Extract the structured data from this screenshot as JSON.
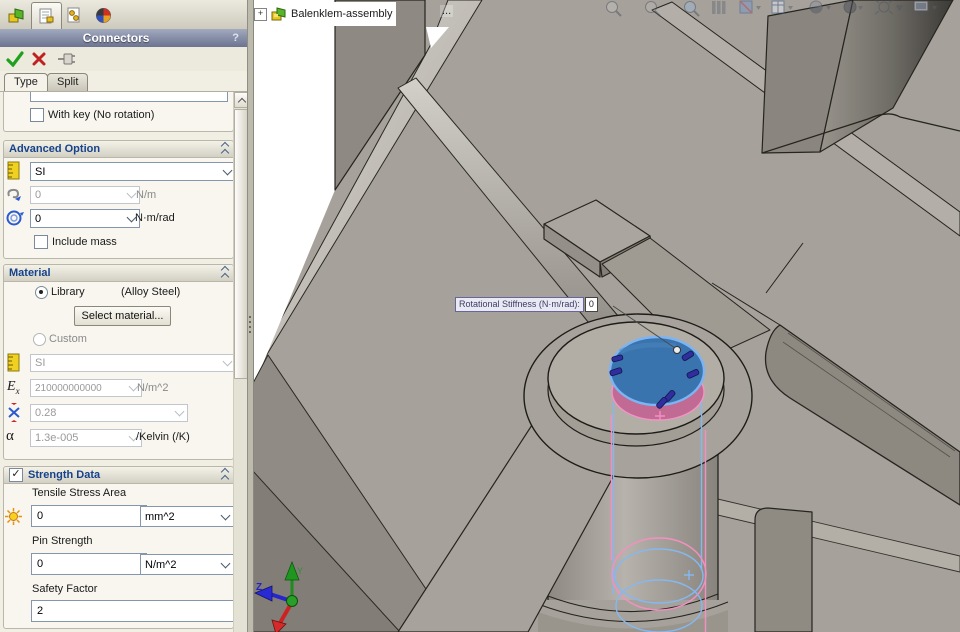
{
  "colors": {
    "header_grad_top": "#a2aabf",
    "header_grad_bottom": "#6b7390",
    "panel_bg": "#f1efe4",
    "group_header_text": "#15428b",
    "selection_blue": "#7cb4f4",
    "face_blue": "#3a74ae",
    "face_pink": "#c06a94",
    "line_pink": "#f58fc2",
    "line_blue": "#85b8f0",
    "model_gray": "#a6a29b",
    "viewport_bg": "#ffffff"
  },
  "panel": {
    "manager_tabs": [
      "features-icon",
      "propertymanager-icon",
      "configurations-icon",
      "displaymanager-icon"
    ],
    "header": {
      "title": "Connectors",
      "help": "?"
    },
    "actions": [
      "ok",
      "cancel",
      "pin"
    ],
    "page_tabs": [
      {
        "label": "Type"
      },
      {
        "label": "Split"
      }
    ],
    "type_page": {
      "with_key": "With key (No rotation)"
    },
    "advanced": {
      "title": "Advanced Option",
      "units": "SI",
      "axial": {
        "value": "0",
        "unit": "N/m"
      },
      "rotational": {
        "value": "0",
        "unit": "N·m/rad"
      },
      "include_mass": "Include mass"
    },
    "material": {
      "title": "Material",
      "library": "Library",
      "library_value": "(Alloy Steel)",
      "select_button": "Select material...",
      "custom": "Custom",
      "units": "SI",
      "elastic": {
        "symbol": "E",
        "sub": "x",
        "value": "210000000000",
        "unit": "N/m^2"
      },
      "poisson": {
        "value": "0.28"
      },
      "alpha": {
        "symbol": "α",
        "value": "1.3e-005",
        "unit": "/Kelvin (/K)"
      }
    },
    "strength": {
      "title": "Strength Data",
      "tensile_label": "Tensile Stress Area",
      "tensile_value": "0",
      "tensile_unit": "mm^2",
      "pin_label": "Pin Strength",
      "pin_value": "0",
      "pin_unit": "N/m^2",
      "safety_label": "Safety Factor",
      "safety_value": "2"
    }
  },
  "viewport": {
    "tree_item": {
      "expand": "+",
      "label": "Balenklem-assembly",
      "more": "..."
    },
    "tooltip": {
      "label": "Rotational Stiffness (N·m/rad):",
      "value": "0"
    },
    "triad": {
      "y": "Y",
      "z": "Z"
    }
  }
}
